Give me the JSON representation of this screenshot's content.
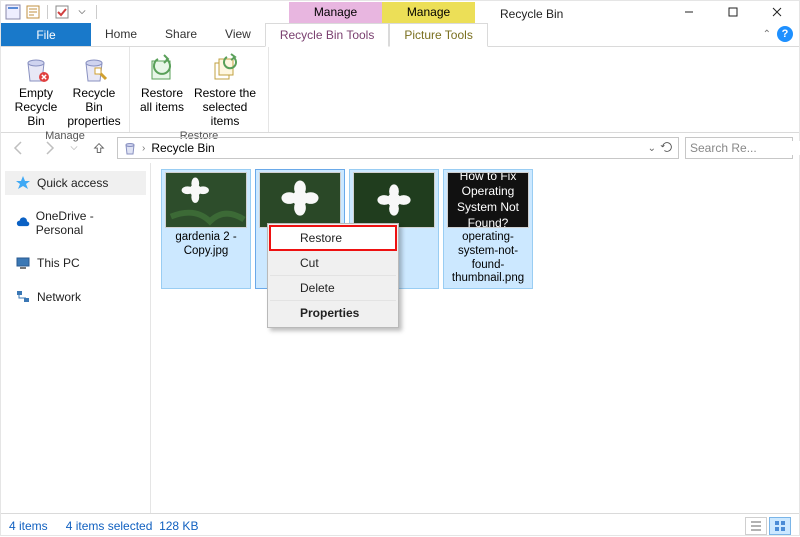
{
  "window": {
    "title": "Recycle Bin",
    "contextual_tabs": [
      {
        "label": "Manage",
        "group": "Recycle Bin Tools"
      },
      {
        "label": "Manage",
        "group": "Picture Tools"
      }
    ]
  },
  "ribbon": {
    "file_tab": "File",
    "tabs": [
      "Home",
      "Share",
      "View"
    ],
    "context_tabs": [
      "Recycle Bin Tools",
      "Picture Tools"
    ],
    "groups": {
      "manage": {
        "label": "Manage",
        "empty": "Empty\nRecycle Bin",
        "properties": "Recycle Bin\nproperties"
      },
      "restore": {
        "label": "Restore",
        "restore_all": "Restore\nall items",
        "restore_selected": "Restore the\nselected items"
      }
    }
  },
  "address": {
    "location": "Recycle Bin"
  },
  "search": {
    "placeholder": "Search Re..."
  },
  "nav": {
    "quick_access": "Quick access",
    "onedrive": "OneDrive - Personal",
    "this_pc": "This PC",
    "network": "Network"
  },
  "files": [
    {
      "label": "gardenia 2 - Copy.jpg",
      "kind": "flower"
    },
    {
      "label": "",
      "kind": "flower"
    },
    {
      "label": "",
      "kind": "flower"
    },
    {
      "label": "operating-system-not-found-thumbnail.png",
      "kind": "dark",
      "thumb_text": "How to Fix Operating System Not Found?"
    }
  ],
  "context_menu": {
    "restore": "Restore",
    "cut": "Cut",
    "delete": "Delete",
    "properties": "Properties"
  },
  "status": {
    "item_count": "4 items",
    "selection": "4 items selected",
    "size": "128 KB"
  }
}
